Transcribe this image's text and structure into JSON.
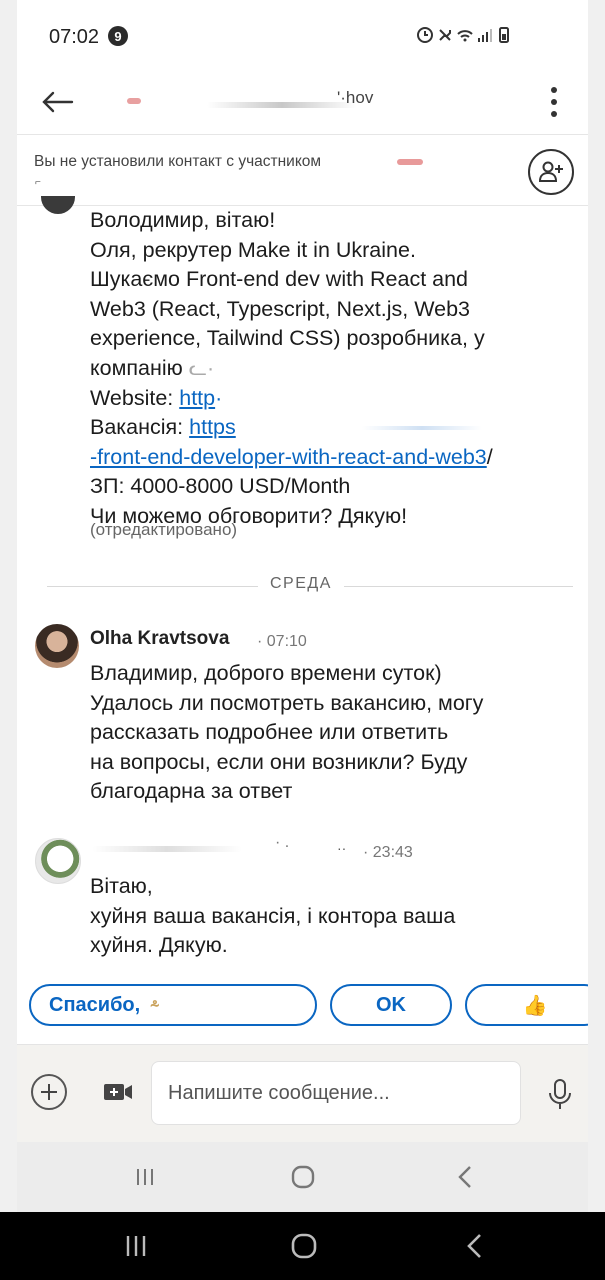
{
  "status_bar": {
    "time": "07:02",
    "notification_count": "9"
  },
  "header": {
    "contact_name_visible": "'·hov"
  },
  "banner": {
    "text": "Вы не установили контакт с участником"
  },
  "first_message": {
    "lines": [
      "Володимир, вітаю!",
      "Оля, рекрутер Make it in Ukraine.",
      "Шукаємо Front-end dev with React and",
      "Web3 (React, Typescript, Next.js, Web3",
      "experience, Tailwind CSS)  розробника, у",
      "компанію"
    ],
    "website_label": "Website:",
    "website_link": "http",
    "vacancy_label": "Вакансія:",
    "vacancy_link": "https",
    "vacancy_link_cont": "-front-end-developer-with-react-and-web3",
    "vacancy_link_slash": "/",
    "salary": "ЗП: 4000-8000 USD/Month",
    "closing": "Чи можемо обговорити? Дякую!",
    "edited_label": "(отредактировано)"
  },
  "day_divider": "СРЕДА",
  "second_message": {
    "sender": "Olha Kravtsova",
    "time": "07:10",
    "lines": [
      "Владимир, доброго времени суток)",
      "Удалось ли посмотреть вакансию, могу",
      "рассказать подробнее или ответить",
      "на вопросы, если они возникли? Буду",
      "благодарна за ответ"
    ]
  },
  "third_message": {
    "time": "23:43",
    "lines": [
      "Вітаю,",
      "хуйня ваша вакансія, і контора ваша",
      "хуйня. Дякую."
    ]
  },
  "quick_replies": [
    "Спасибо,",
    "OK",
    "👍"
  ],
  "composer": {
    "placeholder": "Напишите сообщение..."
  },
  "colors": {
    "accent": "#0a66c2",
    "background": "#ffffff",
    "composer_bg": "#f3f2ef"
  },
  "icons": [
    "back-arrow-icon",
    "more-vertical-icon",
    "add-connection-icon",
    "plus-icon",
    "video-icon",
    "microphone-icon",
    "recent-apps-icon",
    "home-icon",
    "back-icon"
  ]
}
